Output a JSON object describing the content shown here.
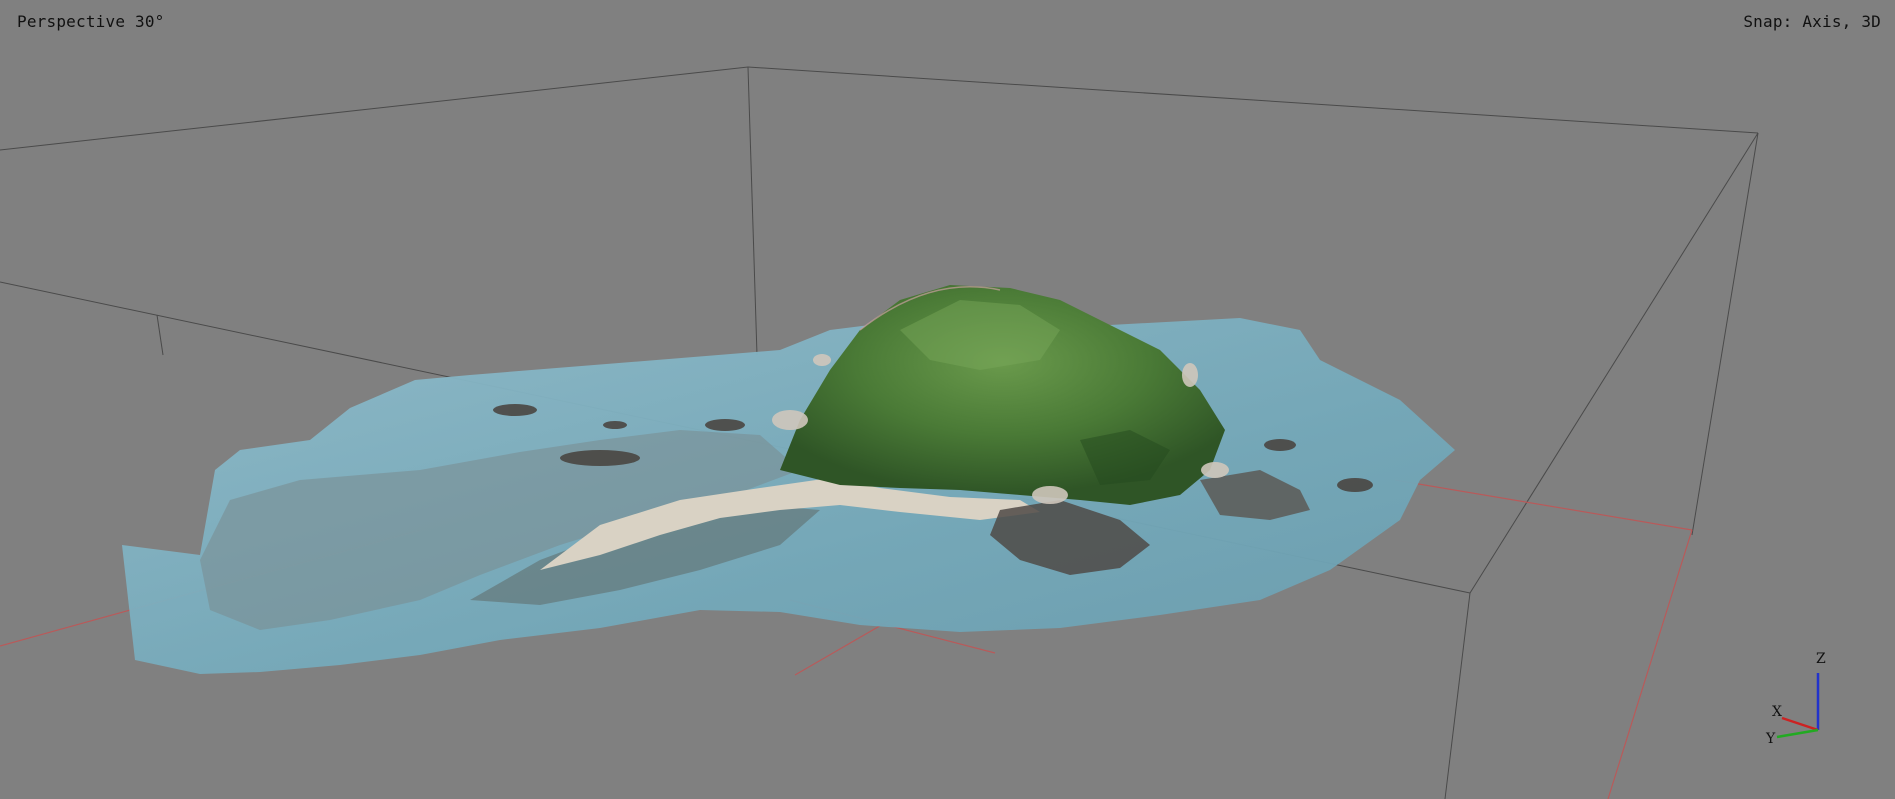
{
  "viewport": {
    "view_mode_label": "Perspective 30°",
    "snap_label": "Snap: Axis, 3D",
    "background_color": "#808080",
    "bounding_box_color": "#4a4a4a",
    "ground_axis_color": "#b85a5a"
  },
  "model": {
    "object": "island-photogrammetry-mesh",
    "colors": {
      "water": "#7fb2c2",
      "shallow_water": "#9cc4cf",
      "vegetation": "#4f7f3a",
      "vegetation_dark": "#2f5a26",
      "sand": "#d9d2c4",
      "rock": "#5a5550"
    }
  },
  "axis_gizmo": {
    "x_label": "X",
    "y_label": "Y",
    "z_label": "Z",
    "x_color": "#cc2222",
    "y_color": "#22aa22",
    "z_color": "#2233cc"
  }
}
